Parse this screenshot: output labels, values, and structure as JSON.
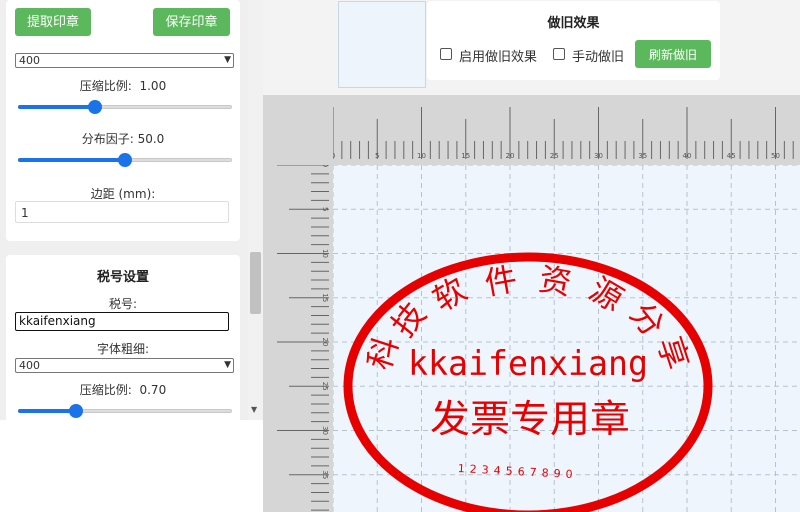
{
  "toolbar": {
    "extract_label": "提取印章",
    "save_label": "保存印章"
  },
  "text_settings": {
    "font_weight_value": "400",
    "compress_label": "压缩比例:",
    "compress_value": "1.00",
    "compress_level": 0.36,
    "distribution_label": "分布因子:",
    "distribution_value": "50.0",
    "distribution_level": 0.5,
    "margin_label": "边距 (mm):",
    "margin_value": "1"
  },
  "tax_settings": {
    "heading": "税号设置",
    "tax_label": "税号:",
    "tax_value": "kkaifenxiang",
    "weight_label": "字体粗细:",
    "weight_value": "400",
    "compress_label": "压缩比例:",
    "compress_value": "0.70",
    "compress_level": 0.27
  },
  "aging": {
    "title": "做旧效果",
    "enable_label": "启用做旧效果",
    "manual_label": "手动做旧",
    "refresh_label": "刷新做旧"
  },
  "ruler": {
    "top_ticks": [
      "0",
      "5",
      "10",
      "15",
      "20",
      "25",
      "30",
      "35",
      "40",
      "45",
      "50"
    ],
    "left_ticks": [
      "0",
      "5",
      "10",
      "15",
      "20",
      "25",
      "30",
      "35"
    ]
  },
  "stamp": {
    "company_chars": [
      "科",
      "技",
      "软",
      "件",
      "资",
      "源",
      "分",
      "享"
    ],
    "tax_number": "kkaifenxiang",
    "type_text": "发票专用章",
    "serial": "1234567890",
    "color": "#e60000"
  },
  "colors": {
    "accent": "#1a73e8",
    "button_green": "#5cb85c"
  }
}
